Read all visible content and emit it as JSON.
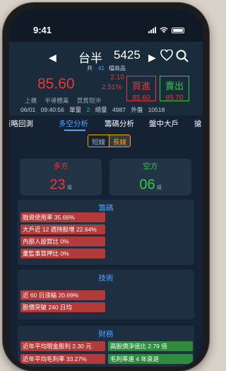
{
  "status": {
    "time": "9:41"
  },
  "header": {
    "stock_name": "台半",
    "stock_code": "5425",
    "total_prefix": "共",
    "total_count": "41",
    "total_suffix": "檔商品",
    "price": "85.60",
    "change": "2.10",
    "change_pct": "2.51%",
    "buy_label": "買進",
    "buy_price": "85.60",
    "sell_label": "賣出",
    "sell_price": "85.70",
    "market": "上櫃",
    "industry": "半導體業",
    "type": "買賣現沖",
    "date": "06/01",
    "clock": "09:40:56",
    "single_label": "單量",
    "single_value": "2",
    "total_label": "總量",
    "total_value": "4987",
    "outer_label": "外盤",
    "outer_value": "10518"
  },
  "tabs": [
    "策略回測",
    "多空分析",
    "籌碼分析",
    "盤中大戶",
    "搶"
  ],
  "toggle": {
    "short_term": "短線",
    "long_term": "長線"
  },
  "cards": {
    "long": {
      "title": "多方",
      "count": "23",
      "unit": "項"
    },
    "short": {
      "title": "空方",
      "count": "06",
      "unit": "項"
    }
  },
  "sections": {
    "chips": {
      "title": "籌碼",
      "items": [
        "融資使用率 35.66%",
        "大戶近 12 週持股增 22.64%",
        "內部人設質比 0%",
        "董監事質押比 0%"
      ]
    },
    "tech": {
      "title": "技術",
      "items": [
        "近 60 日漲幅 20.69%",
        "股價突破 240 日均"
      ]
    },
    "finance": {
      "title": "財務",
      "red_items": [
        "近年平均現金股利 2.30 元",
        "近年平均毛利率 33.27%"
      ],
      "green_items": [
        "高股價淨值比 2.79 倍",
        "毛利率連 4 年衰退"
      ]
    }
  },
  "colors": {
    "up": "#e53935",
    "down": "#2ecc40",
    "accent": "#4da3ff",
    "toggle": "#f0a500"
  }
}
